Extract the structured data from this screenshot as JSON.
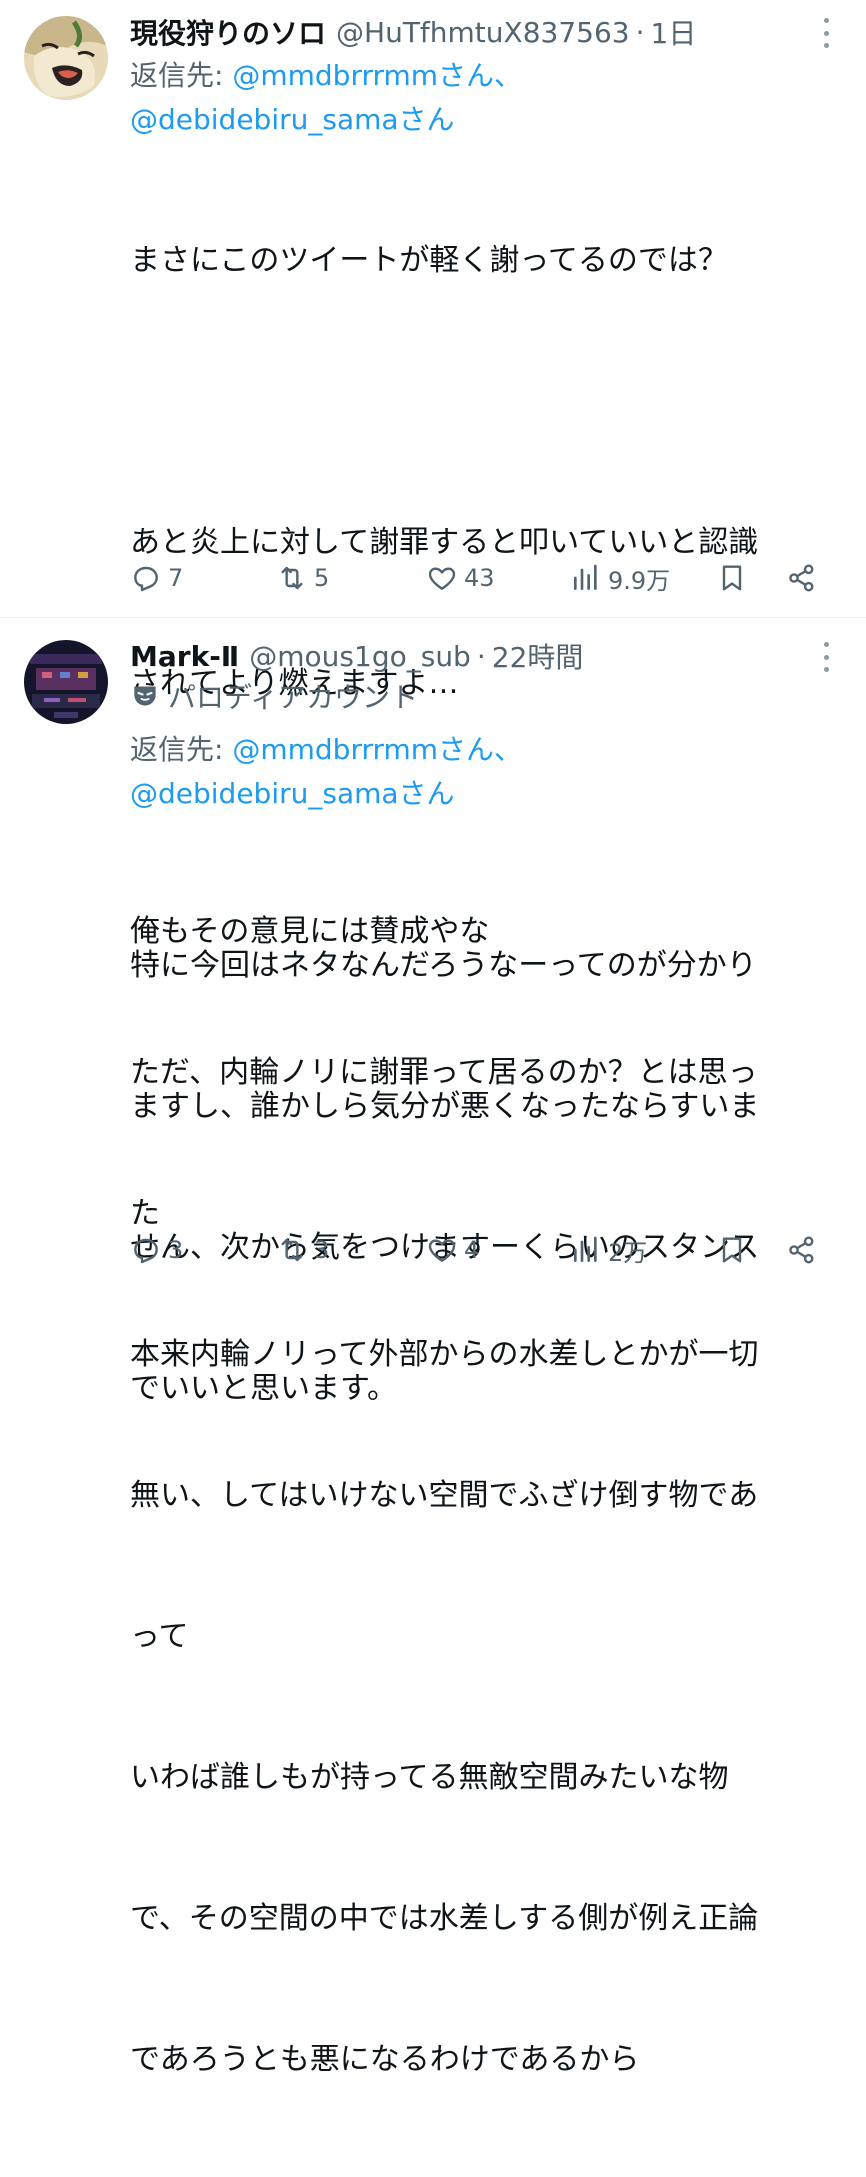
{
  "tweets": [
    {
      "name": "現役狩りのソロ",
      "handle": "@HuTfhmtuX837563",
      "time": "1日",
      "reply_prefix": "返信先: ",
      "mention1": "@mmdbrrrmmさん、",
      "mention2": "@debidebiru_samaさん",
      "lines": [
        "まさにこのツイートが軽く謝ってるのでは？",
        "",
        "あと炎上に対して謝罪すると叩いていいと認識",
        "されてより燃えますよ…",
        "",
        "特に今回はネタなんだろうなーってのが分かり",
        "ますし、誰かしら気分が悪くなったならすいま",
        "せん、次から気をつけますーくらいのスタンス",
        "でいいと思います。"
      ],
      "replies": "7",
      "retweets": "5",
      "likes": "43",
      "views": "9.9万"
    },
    {
      "name": "Mark-Ⅱ",
      "handle": "@mous1go_sub",
      "time": "22時間",
      "parody_label": "パロディアカウント",
      "reply_prefix": "返信先: ",
      "mention1": "@mmdbrrrmmさん、",
      "mention2": "@debidebiru_samaさん",
      "lines": [
        "俺もその意見には賛成やな",
        "ただ、内輪ノリに謝罪って居るのか？とは思っ",
        "た",
        "本来内輪ノリって外部からの水差しとかが一切",
        "無い、してはいけない空間でふざけ倒す物であ",
        "って",
        "いわば誰しもが持ってる無敵空間みたいな物",
        "で、その空間の中では水差しする側が例え正論",
        "であろうとも悪になるわけであるから"
      ],
      "replies": "3",
      "retweets": "3",
      "likes": "4",
      "views": "2万"
    }
  ],
  "icons": {
    "reply": "reply-icon",
    "retweet": "retweet-icon",
    "like": "heart-icon",
    "views": "views-icon",
    "bookmark": "bookmark-icon",
    "share": "share-icon",
    "more": "more-icon",
    "parody": "mask-icon"
  },
  "colors": {
    "mention": "#1d9bf0",
    "secondary": "#536471",
    "text": "#0f1419"
  }
}
